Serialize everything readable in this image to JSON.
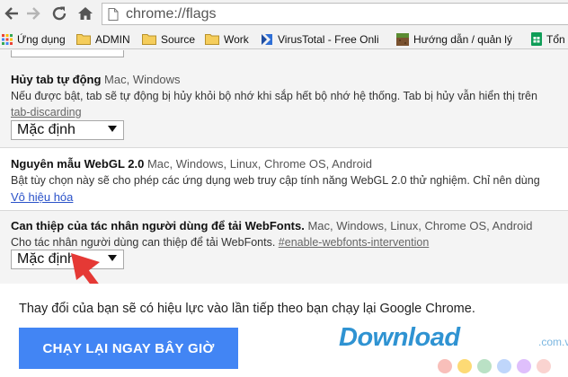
{
  "address_bar": {
    "url": "chrome://flags"
  },
  "bookmarks": [
    {
      "label": "Ứng dụng",
      "icon": "apps-grid-icon"
    },
    {
      "label": "ADMIN",
      "icon": "folder-icon"
    },
    {
      "label": "Source",
      "icon": "folder-icon"
    },
    {
      "label": "Work",
      "icon": "folder-icon"
    },
    {
      "label": "VirusTotal - Free Onli",
      "icon": "virustotal-icon"
    },
    {
      "label": "Hướng dẫn / quản lý",
      "icon": "minecraft-icon"
    },
    {
      "label": "Tổn",
      "icon": "sheets-icon"
    }
  ],
  "experiments": [
    {
      "title": "Hủy tab tự động",
      "platforms": "Mac, Windows",
      "description": "Nếu được bật, tab sẽ tự động bị hủy khỏi bộ nhớ khi sắp hết bộ nhớ hệ thống. Tab bị hủy vẫn hiển thị trên",
      "tag": "#enable-tab-discarding",
      "tag_visible": "tab-discarding",
      "select_value": "Mặc định"
    },
    {
      "title": "Nguyên mẫu WebGL 2.0",
      "platforms": "Mac, Windows, Linux, Chrome OS, Android",
      "description": "Bật tùy chọn này sẽ cho phép các ứng dụng web truy cập tính năng WebGL 2.0 thử nghiệm. Chỉ nên dùng",
      "link": "Vô hiệu hóa"
    },
    {
      "title": "Can thiệp của tác nhân người dùng để tải WebFonts.",
      "platforms": "Mac, Windows, Linux, Chrome OS, Android",
      "description": "Cho tác nhân người dùng can thiệp để tải WebFonts.",
      "tag": "#enable-webfonts-intervention",
      "select_value": "Mặc định"
    }
  ],
  "notice": {
    "text": "Thay đổi của bạn sẽ có hiệu lực vào lần tiếp theo bạn chạy lại Google Chrome.",
    "button": "CHẠY LẠI NGAY BÂY GIỜ"
  },
  "watermark": {
    "text": "Download",
    "suffix": ".com.vn",
    "dot_colors": [
      "#f28b82",
      "#fbbc04",
      "#81c995",
      "#8ab4f8",
      "#c58af9",
      "#f6aea9"
    ]
  },
  "colors": {
    "accent": "#4285f4",
    "link": "#2a52c9",
    "arrow": "#e53935"
  }
}
